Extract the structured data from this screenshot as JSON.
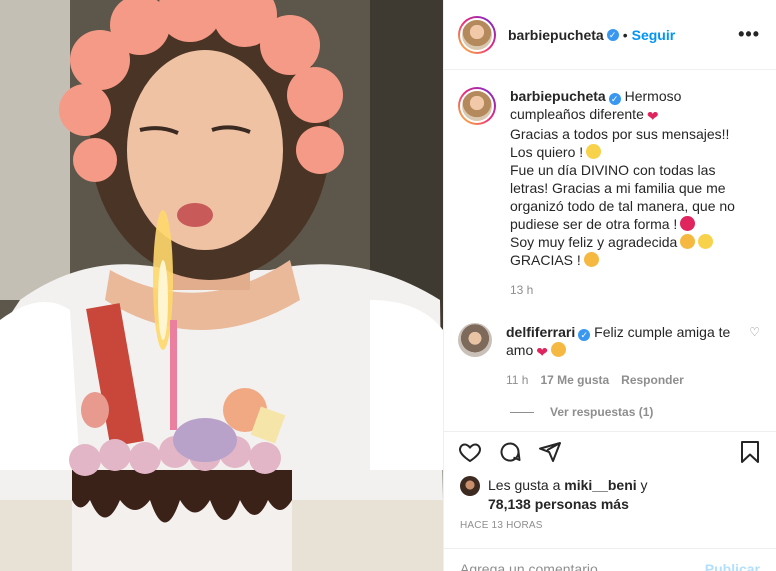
{
  "post": {
    "image_alt": "Mujer soplando velas de cumpleaños"
  },
  "header": {
    "username": "barbiepucheta",
    "verified_icon": "verified-badge-icon",
    "separator": "•",
    "follow_label": "Seguir",
    "more_icon": "more-options-icon",
    "more_text": "•••"
  },
  "caption": {
    "username": "barbiepucheta",
    "line1": "Hermoso cumpleaños diferente",
    "line2": "Gracias a todos por sus mensajes!! Los quiero !",
    "line3": "Fue un día DIVINO con todas las letras! Gracias a mi familia que me organizó todo de tal manera, que no pudiese ser de otra forma !",
    "line4": "Soy muy feliz y agradecida",
    "line5": "GRACIAS !",
    "time": "13 h"
  },
  "comment": {
    "username": "delfiferrari",
    "text": "Feliz cumple amiga te amo",
    "time": "11 h",
    "likes": "17 Me gusta",
    "reply_label": "Responder",
    "view_replies": "Ver respuestas (1)"
  },
  "likes": {
    "prefix": "Les gusta a",
    "user": "miki__beni",
    "conj": "y",
    "count": "78,138 personas más"
  },
  "timestamp": "HACE 13 HORAS",
  "add_comment": {
    "placeholder": "Agrega un comentario...",
    "publish_label": "Publicar"
  },
  "colors": {
    "accent": "#0095f6",
    "heart": "#e0245e"
  }
}
